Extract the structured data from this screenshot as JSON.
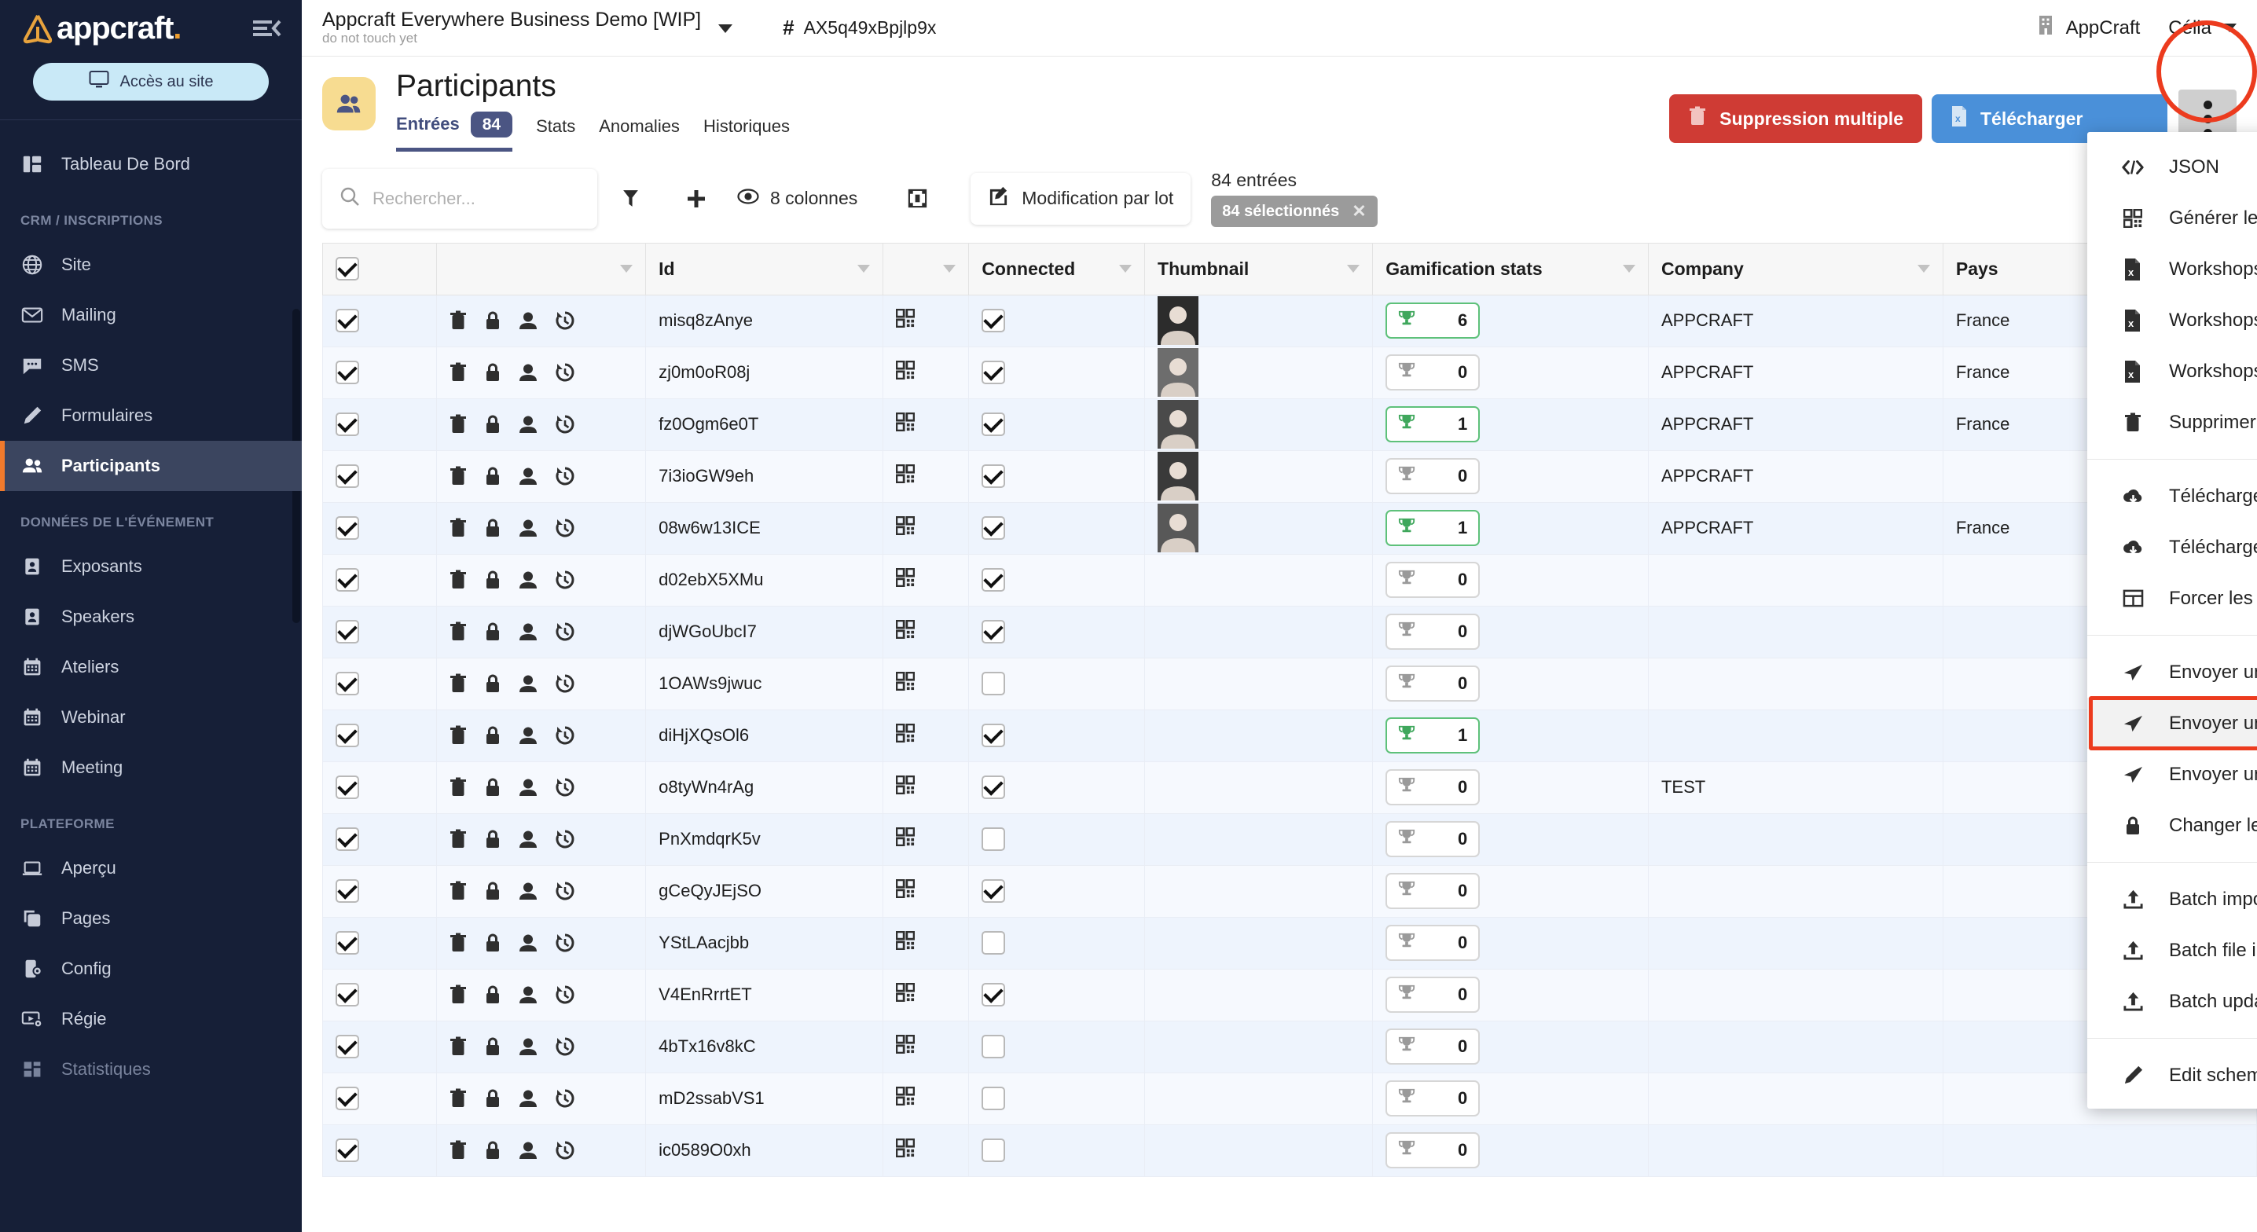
{
  "brand": {
    "name": "appcraft",
    "dot": ".",
    "collapse_icon": "collapse-sidebar-icon"
  },
  "sidebar": {
    "access_button": "Accès au site",
    "groups": [
      {
        "label": "",
        "items": [
          {
            "label": "Tableau De Bord",
            "icon": "dashboard-icon",
            "state": "normal"
          }
        ]
      },
      {
        "label": "CRM / INSCRIPTIONS",
        "items": [
          {
            "label": "Site",
            "icon": "globe-icon",
            "state": "normal"
          },
          {
            "label": "Mailing",
            "icon": "envelope-icon",
            "state": "normal"
          },
          {
            "label": "SMS",
            "icon": "chat-bubble-icon",
            "state": "normal"
          },
          {
            "label": "Formulaires",
            "icon": "pencil-icon",
            "state": "normal"
          },
          {
            "label": "Participants",
            "icon": "people-icon",
            "state": "active"
          }
        ]
      },
      {
        "label": "DONNÉES DE L'ÉVÉNEMENT",
        "items": [
          {
            "label": "Exposants",
            "icon": "badge-person-icon",
            "state": "normal"
          },
          {
            "label": "Speakers",
            "icon": "badge-person-icon",
            "state": "normal"
          },
          {
            "label": "Ateliers",
            "icon": "calendar-icon",
            "state": "normal"
          },
          {
            "label": "Webinar",
            "icon": "calendar-icon",
            "state": "normal"
          },
          {
            "label": "Meeting",
            "icon": "calendar-icon",
            "state": "normal"
          }
        ]
      },
      {
        "label": "PLATEFORME",
        "items": [
          {
            "label": "Aperçu",
            "icon": "laptop-icon",
            "state": "normal"
          },
          {
            "label": "Pages",
            "icon": "copy-pages-icon",
            "state": "normal"
          },
          {
            "label": "Config",
            "icon": "mobile-gear-icon",
            "state": "normal"
          },
          {
            "label": "Régie",
            "icon": "video-gear-icon",
            "state": "normal"
          },
          {
            "label": "Statistiques",
            "icon": "stats-icon",
            "state": "dim"
          }
        ]
      }
    ]
  },
  "topbar": {
    "project_title": "Appcraft Everywhere Business Demo [WIP]",
    "project_subtitle": "do not touch yet",
    "project_caret": "chevron-down-icon",
    "hash_symbol": "#",
    "event_id": "AX5q49xBpjlp9x",
    "org_icon": "building-icon",
    "org_name": "AppCraft",
    "user_name": "Célia",
    "user_caret": "chevron-down-icon"
  },
  "page": {
    "avatar_icon": "people-icon",
    "title": "Participants",
    "tabs": [
      {
        "label": "Entrées",
        "badge": "84",
        "active": true
      },
      {
        "label": "Stats",
        "badge": "",
        "active": false
      },
      {
        "label": "Anomalies",
        "badge": "",
        "active": false
      },
      {
        "label": "Historiques",
        "badge": "",
        "active": false
      }
    ],
    "actions": {
      "delete_multiple": "Suppression multiple",
      "delete_icon": "trash-icon",
      "download": "Télécharger",
      "download_icon": "excel-file-icon",
      "kebab_icon": "more-vertical-icon"
    }
  },
  "toolbar": {
    "search_placeholder": "Rechercher...",
    "search_value": "",
    "search_icon": "search-icon",
    "filter_icon": "funnel-icon",
    "add_icon": "plus-icon",
    "columns_icon": "eye-icon",
    "columns_label": "8 colonnes",
    "resize_icon": "fit-columns-icon",
    "batch_edit_icon": "edit-square-icon",
    "batch_edit_label": "Modification par lot",
    "entries_count": "84 entrées",
    "selected_chip": "84 sélectionnés",
    "selected_close_icon": "close-icon"
  },
  "table": {
    "columns": [
      {
        "key": "check",
        "label": "",
        "sortable": false
      },
      {
        "key": "actions",
        "label": "",
        "sortable": true
      },
      {
        "key": "id",
        "label": "Id",
        "sortable": true
      },
      {
        "key": "qr",
        "label": "",
        "sortable": true
      },
      {
        "key": "connected",
        "label": "Connected",
        "sortable": true
      },
      {
        "key": "thumbnail",
        "label": "Thumbnail",
        "sortable": true
      },
      {
        "key": "gamification",
        "label": "Gamification stats",
        "sortable": true
      },
      {
        "key": "company",
        "label": "Company",
        "sortable": true
      },
      {
        "key": "pays",
        "label": "Pays",
        "sortable": false
      }
    ],
    "header_checkbox_checked": true,
    "row_action_icons": [
      "trash-icon",
      "lock-icon",
      "person-icon",
      "history-icon"
    ],
    "qr_icon": "qrcode-icon",
    "trophy_icon": "trophy-icon",
    "rows": [
      {
        "selected": true,
        "id": "misq8zAnye",
        "connected": true,
        "thumbnail": true,
        "gami": "6",
        "gami_green": true,
        "company": "APPCRAFT",
        "pays": "France"
      },
      {
        "selected": true,
        "id": "zj0m0oR08j",
        "connected": true,
        "thumbnail": true,
        "gami": "0",
        "gami_green": false,
        "company": "APPCRAFT",
        "pays": "France"
      },
      {
        "selected": true,
        "id": "fz0Ogm6e0T",
        "connected": true,
        "thumbnail": true,
        "gami": "1",
        "gami_green": true,
        "company": "APPCRAFT",
        "pays": "France"
      },
      {
        "selected": true,
        "id": "7i3ioGW9eh",
        "connected": true,
        "thumbnail": true,
        "gami": "0",
        "gami_green": false,
        "company": "APPCRAFT",
        "pays": ""
      },
      {
        "selected": true,
        "id": "08w6w13ICE",
        "connected": true,
        "thumbnail": true,
        "gami": "1",
        "gami_green": true,
        "company": "APPCRAFT",
        "pays": "France"
      },
      {
        "selected": true,
        "id": "d02ebX5XMu",
        "connected": true,
        "thumbnail": false,
        "gami": "0",
        "gami_green": false,
        "company": "",
        "pays": ""
      },
      {
        "selected": true,
        "id": "djWGoUbcI7",
        "connected": true,
        "thumbnail": false,
        "gami": "0",
        "gami_green": false,
        "company": "",
        "pays": ""
      },
      {
        "selected": true,
        "id": "1OAWs9jwuc",
        "connected": false,
        "thumbnail": false,
        "gami": "0",
        "gami_green": false,
        "company": "",
        "pays": ""
      },
      {
        "selected": true,
        "id": "diHjXQsOl6",
        "connected": true,
        "thumbnail": false,
        "gami": "1",
        "gami_green": true,
        "company": "",
        "pays": ""
      },
      {
        "selected": true,
        "id": "o8tyWn4rAg",
        "connected": true,
        "thumbnail": false,
        "gami": "0",
        "gami_green": false,
        "company": "TEST",
        "pays": ""
      },
      {
        "selected": true,
        "id": "PnXmdqrK5v",
        "connected": false,
        "thumbnail": false,
        "gami": "0",
        "gami_green": false,
        "company": "",
        "pays": ""
      },
      {
        "selected": true,
        "id": "gCeQyJEjSO",
        "connected": true,
        "thumbnail": false,
        "gami": "0",
        "gami_green": false,
        "company": "",
        "pays": ""
      },
      {
        "selected": true,
        "id": "YStLAacjbb",
        "connected": false,
        "thumbnail": false,
        "gami": "0",
        "gami_green": false,
        "company": "",
        "pays": ""
      },
      {
        "selected": true,
        "id": "V4EnRrrtET",
        "connected": true,
        "thumbnail": false,
        "gami": "0",
        "gami_green": false,
        "company": "",
        "pays": ""
      },
      {
        "selected": true,
        "id": "4bTx16v8kC",
        "connected": false,
        "thumbnail": false,
        "gami": "0",
        "gami_green": false,
        "company": "",
        "pays": ""
      },
      {
        "selected": true,
        "id": "mD2ssabVS1",
        "connected": false,
        "thumbnail": false,
        "gami": "0",
        "gami_green": false,
        "company": "",
        "pays": ""
      },
      {
        "selected": true,
        "id": "ic0589O0xh",
        "connected": false,
        "thumbnail": false,
        "gami": "0",
        "gami_green": false,
        "company": "",
        "pays": ""
      }
    ]
  },
  "menu": {
    "items": [
      {
        "label": "JSON",
        "icon": "code-icon",
        "sep_after": false
      },
      {
        "label": "Générer les qrcodes",
        "icon": "qrcode-icon",
        "sep_after": false
      },
      {
        "label": "Workshops - inscriptions",
        "icon": "excel-file-icon",
        "sep_after": false
      },
      {
        "label": "Workshops - vues par jour",
        "icon": "excel-file-icon",
        "sep_after": false
      },
      {
        "label": "Workshops - replays par jour",
        "icon": "excel-file-icon",
        "sep_after": false
      },
      {
        "label": "Supprimer les inscriptions aux sessions",
        "icon": "trash-icon",
        "sep_after": true
      },
      {
        "label": "Télécharger les fichiers",
        "icon": "cloud-download-icon",
        "sep_after": false
      },
      {
        "label": "Télécharger les badges",
        "icon": "cloud-download-icon",
        "sep_after": false
      },
      {
        "label": "Forcer les créneaux de rendez-vous",
        "icon": "table-icon",
        "sep_after": true
      },
      {
        "label": "Envoyer un mail",
        "icon": "send-icon",
        "sep_after": false
      },
      {
        "label": "Envoyer un SMS",
        "icon": "send-icon",
        "sep_after": false,
        "highlight": true
      },
      {
        "label": "Envoyer un mail d'activation",
        "icon": "send-icon",
        "sep_after": false
      },
      {
        "label": "Changer le mot de passe",
        "icon": "lock-icon",
        "sep_after": true
      },
      {
        "label": "Batch import",
        "icon": "upload-icon",
        "sep_after": false
      },
      {
        "label": "Batch file import",
        "icon": "upload-icon",
        "sep_after": false
      },
      {
        "label": "Batch update",
        "icon": "upload-icon",
        "sep_after": true
      },
      {
        "label": "Edit schema",
        "icon": "pencil-icon",
        "sep_after": false
      }
    ]
  },
  "annotations": {
    "ellipse_target": "more-vertical-icon",
    "box_target": "Envoyer un SMS",
    "color": "#ec3b1e"
  }
}
